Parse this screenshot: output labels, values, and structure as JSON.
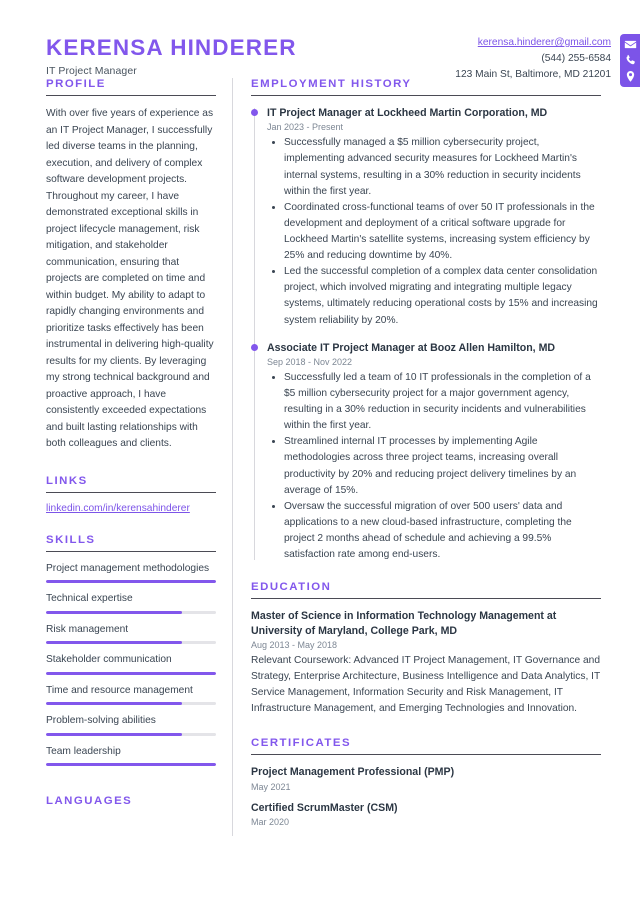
{
  "header": {
    "name": "KERENSA HINDERER",
    "job_title": "IT Project Manager",
    "contact": {
      "email": "kerensa.hinderer@gmail.com",
      "phone": "(544) 255-6584",
      "address": "123 Main St, Baltimore, MD 21201",
      "icons": [
        "envelope-icon",
        "phone-icon",
        "location-pin-icon"
      ]
    }
  },
  "colors": {
    "accent": "#8257ec",
    "link": "#7c54e8",
    "text": "#3a4552",
    "muted": "#7d8794",
    "bar_track": "#e4e4e8"
  },
  "sidebar": {
    "profile": {
      "title": "PROFILE",
      "text": "With over five years of experience as an IT Project Manager, I successfully led diverse teams in the planning, execution, and delivery of complex software development projects. Throughout my career, I have demonstrated exceptional skills in project lifecycle management, risk mitigation, and stakeholder communication, ensuring that projects are completed on time and within budget. My ability to adapt to rapidly changing environments and prioritize tasks effectively has been instrumental in delivering high-quality results for my clients. By leveraging my strong technical background and proactive approach, I have consistently exceeded expectations and built lasting relationships with both colleagues and clients."
    },
    "links": {
      "title": "LINKS",
      "items": [
        {
          "label": "linkedin.com/in/kerensahinderer"
        }
      ]
    },
    "skills": {
      "title": "SKILLS",
      "items": [
        {
          "label": "Project management methodologies",
          "level": 100
        },
        {
          "label": "Technical expertise",
          "level": 80
        },
        {
          "label": "Risk management",
          "level": 80
        },
        {
          "label": "Stakeholder communication",
          "level": 100
        },
        {
          "label": "Time and resource management",
          "level": 80
        },
        {
          "label": "Problem-solving abilities",
          "level": 80
        },
        {
          "label": "Team leadership",
          "level": 100
        }
      ]
    },
    "languages": {
      "title": "LANGUAGES"
    }
  },
  "main": {
    "employment": {
      "title": "EMPLOYMENT HISTORY",
      "jobs": [
        {
          "title": "IT Project Manager at Lockheed Martin Corporation, MD",
          "date": "Jan 2023 - Present",
          "bullets": [
            "Successfully managed a $5 million cybersecurity project, implementing advanced security measures for Lockheed Martin's internal systems, resulting in a 30% reduction in security incidents within the first year.",
            "Coordinated cross-functional teams of over 50 IT professionals in the development and deployment of a critical software upgrade for Lockheed Martin's satellite systems, increasing system efficiency by 25% and reducing downtime by 40%.",
            "Led the successful completion of a complex data center consolidation project, which involved migrating and integrating multiple legacy systems, ultimately reducing operational costs by 15% and increasing system reliability by 20%."
          ]
        },
        {
          "title": "Associate IT Project Manager at Booz Allen Hamilton, MD",
          "date": "Sep 2018 - Nov 2022",
          "bullets": [
            "Successfully led a team of 10 IT professionals in the completion of a $5 million cybersecurity project for a major government agency, resulting in a 30% reduction in security incidents and vulnerabilities within the first year.",
            "Streamlined internal IT processes by implementing Agile methodologies across three project teams, increasing overall productivity by 20% and reducing project delivery timelines by an average of 15%.",
            "Oversaw the successful migration of over 500 users' data and applications to a new cloud-based infrastructure, completing the project 2 months ahead of schedule and achieving a 99.5% satisfaction rate among end-users."
          ]
        }
      ]
    },
    "education": {
      "title": "EDUCATION",
      "entries": [
        {
          "title": "Master of Science in Information Technology Management at University of Maryland, College Park, MD",
          "date": "Aug 2013 - May 2018",
          "description": "Relevant Coursework: Advanced IT Project Management, IT Governance and Strategy, Enterprise Architecture, Business Intelligence and Data Analytics, IT Service Management, Information Security and Risk Management, IT Infrastructure Management, and Emerging Technologies and Innovation."
        }
      ]
    },
    "certificates": {
      "title": "CERTIFICATES",
      "entries": [
        {
          "title": "Project Management Professional (PMP)",
          "date": "May 2021"
        },
        {
          "title": "Certified ScrumMaster (CSM)",
          "date": "Mar 2020"
        }
      ]
    }
  }
}
